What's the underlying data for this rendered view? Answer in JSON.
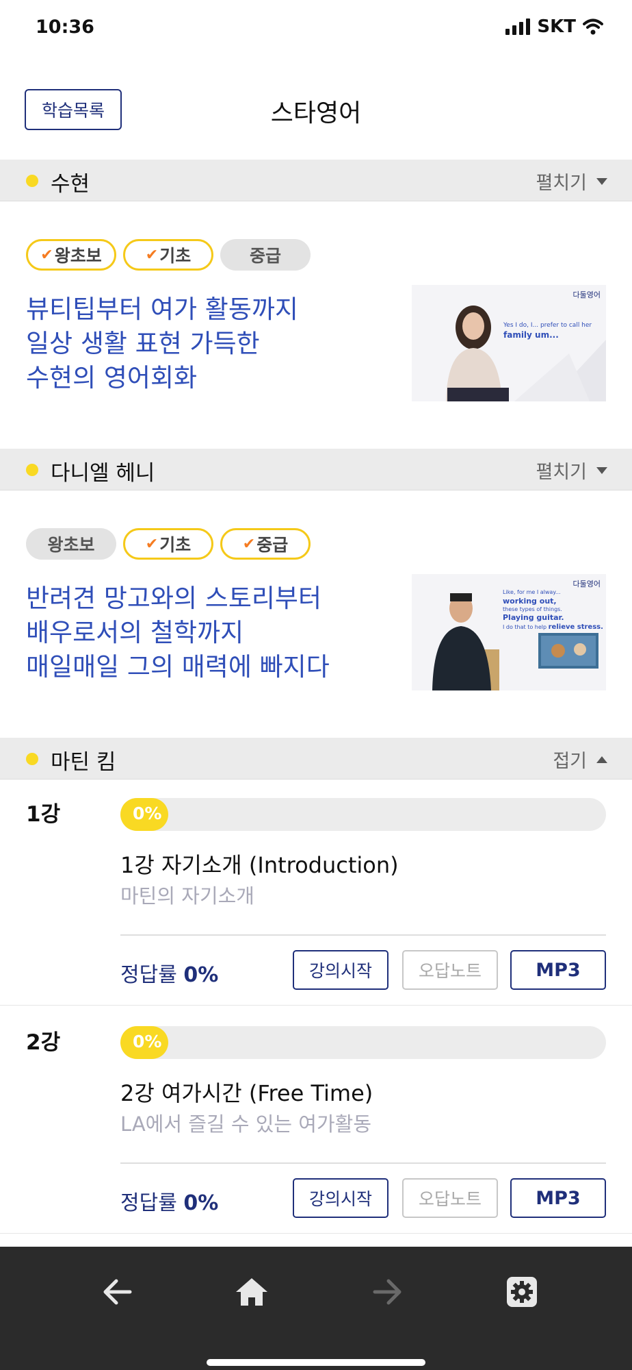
{
  "status": {
    "time": "10:36",
    "carrier": "SKT"
  },
  "header": {
    "list_button": "학습목록",
    "title": "스타영어"
  },
  "sections": [
    {
      "name": "수현",
      "toggle": "펼치기",
      "badges": [
        {
          "label": "왕초보",
          "checked": true
        },
        {
          "label": "기초",
          "checked": true
        },
        {
          "label": "중급",
          "checked": false
        }
      ],
      "desc": [
        "뷰티팁부터 여가 활동까지",
        "일상 생활 표현 가득한",
        "수현의 영어회화"
      ],
      "thumb": {
        "logo": "다둘영어",
        "caption_line1": "Yes I do, I... prefer to call her",
        "caption_line2": "family um..."
      }
    },
    {
      "name": "다니엘 헤니",
      "toggle": "펼치기",
      "badges": [
        {
          "label": "왕초보",
          "checked": false
        },
        {
          "label": "기초",
          "checked": true
        },
        {
          "label": "중급",
          "checked": true
        }
      ],
      "desc": [
        "반려견 망고와의 스토리부터",
        "배우로서의 철학까지",
        "매일매일 그의 매력에 빠지다"
      ],
      "thumb": {
        "logo": "다둘영어",
        "line1": "Like, for me I alway...",
        "line2": "working out,",
        "line3": "these types of things.",
        "line4": "Playing guitar.",
        "line5": "I do that to help",
        "line6": "relieve stress."
      }
    },
    {
      "name": "마틴 킴",
      "toggle": "접기"
    }
  ],
  "lessons": [
    {
      "num": "1강",
      "progress": "0%",
      "title": "1강 자기소개 (Introduction)",
      "subtitle": "마틴의 자기소개",
      "rate_label": "정답률",
      "rate_value": "0%",
      "btn_start": "강의시작",
      "btn_note": "오답노트",
      "btn_mp3": "MP3"
    },
    {
      "num": "2강",
      "progress": "0%",
      "title": "2강 여가시간 (Free Time)",
      "subtitle": "LA에서 즐길 수 있는 여가활동",
      "rate_label": "정답률",
      "rate_value": "0%",
      "btn_start": "강의시작",
      "btn_note": "오답노트",
      "btn_mp3": "MP3"
    }
  ],
  "colors": {
    "accent_yellow": "#f9d923",
    "navy": "#1f2f7a",
    "desc_blue": "#2f4eb8",
    "check_orange": "#f57c22"
  },
  "bottom_nav": [
    "back-arrow-icon",
    "home-icon",
    "forward-arrow-icon",
    "gear-icon"
  ]
}
